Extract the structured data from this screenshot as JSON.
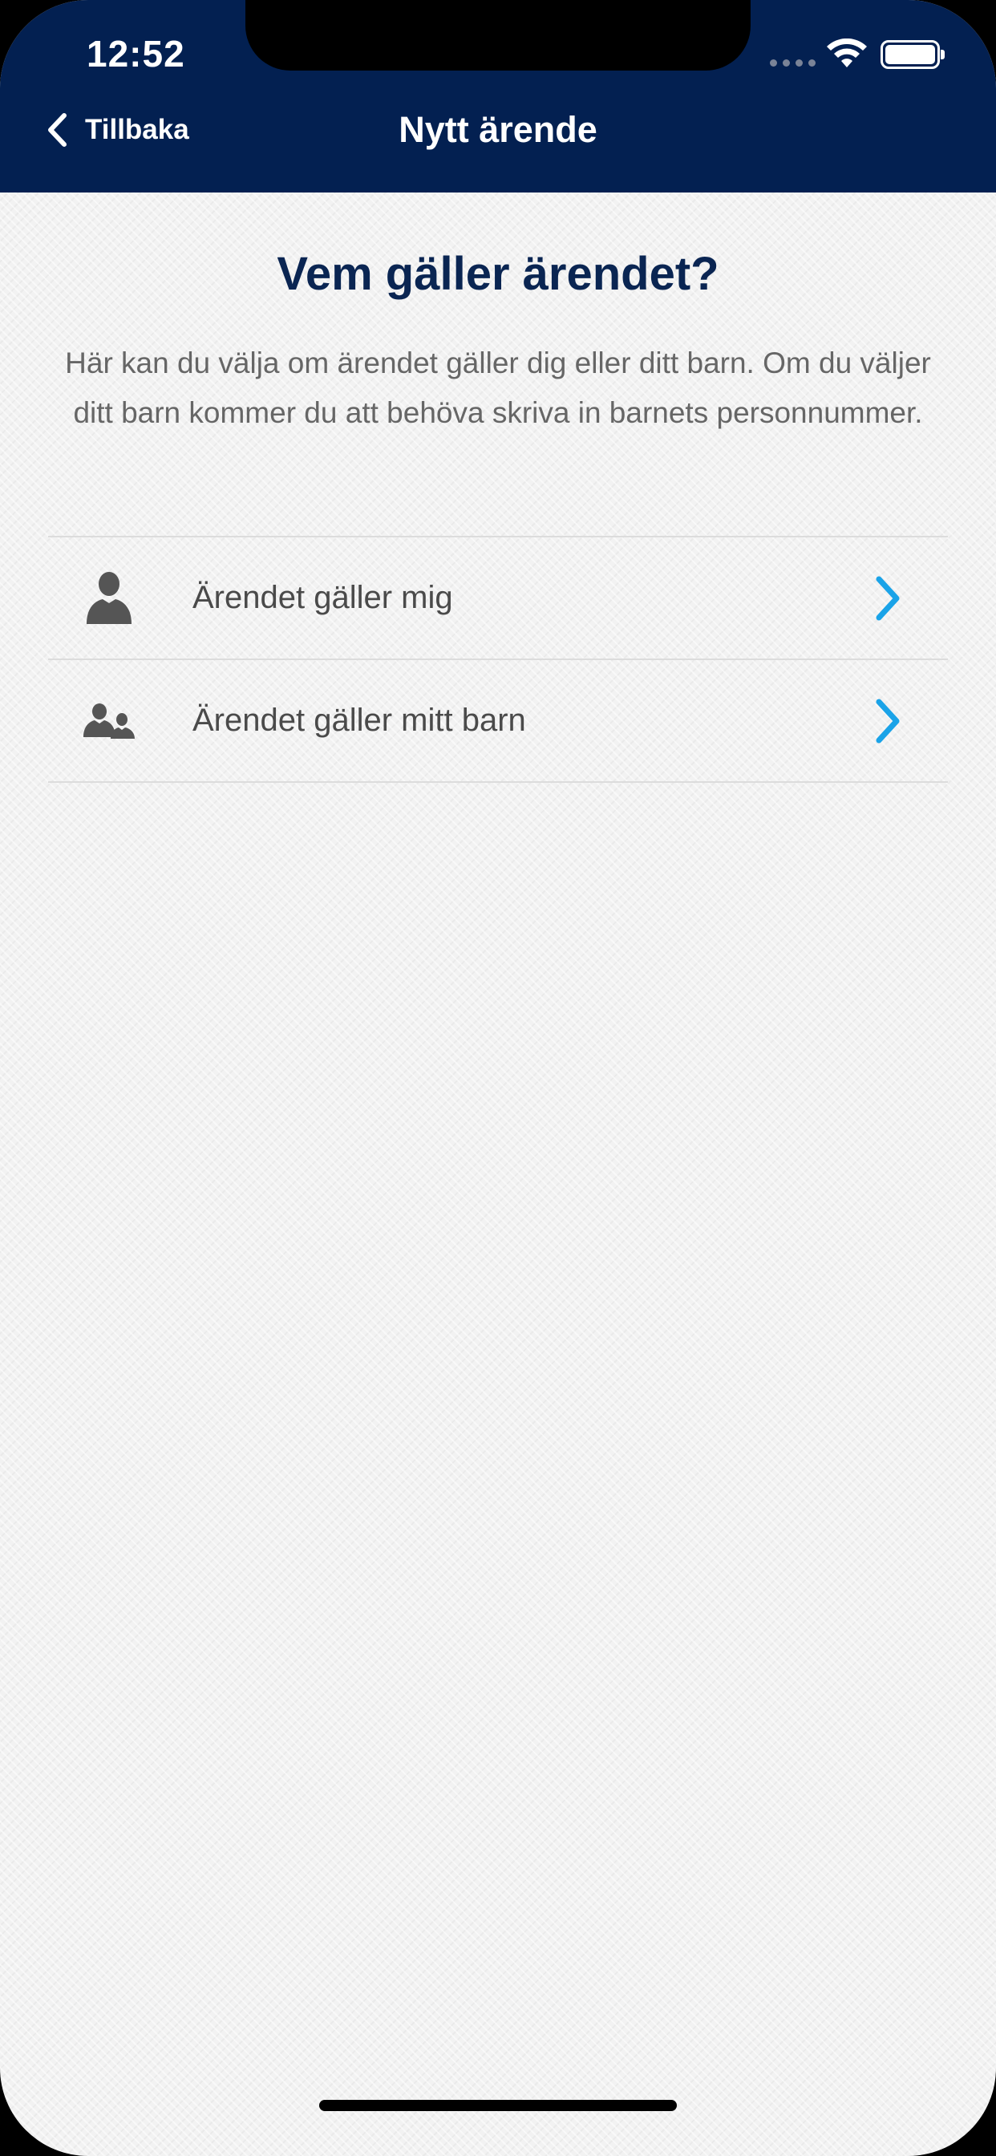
{
  "status_bar": {
    "time": "12:52"
  },
  "nav": {
    "back_label": "Tillbaka",
    "title": "Nytt ärende"
  },
  "content": {
    "question": "Vem gäller ärendet?",
    "description": "Här kan du välja om ärendet gäller dig eller ditt barn. Om du väljer ditt barn kommer du att behöva skriva in barnets personnummer."
  },
  "options": [
    {
      "label": "Ärendet gäller mig",
      "icon": "person-icon"
    },
    {
      "label": "Ärendet gäller mitt barn",
      "icon": "parent-child-icon"
    }
  ],
  "colors": {
    "header_bg": "#032051",
    "title_color": "#0a2552",
    "chevron": "#1aa3e8",
    "text_gray": "#666666"
  }
}
